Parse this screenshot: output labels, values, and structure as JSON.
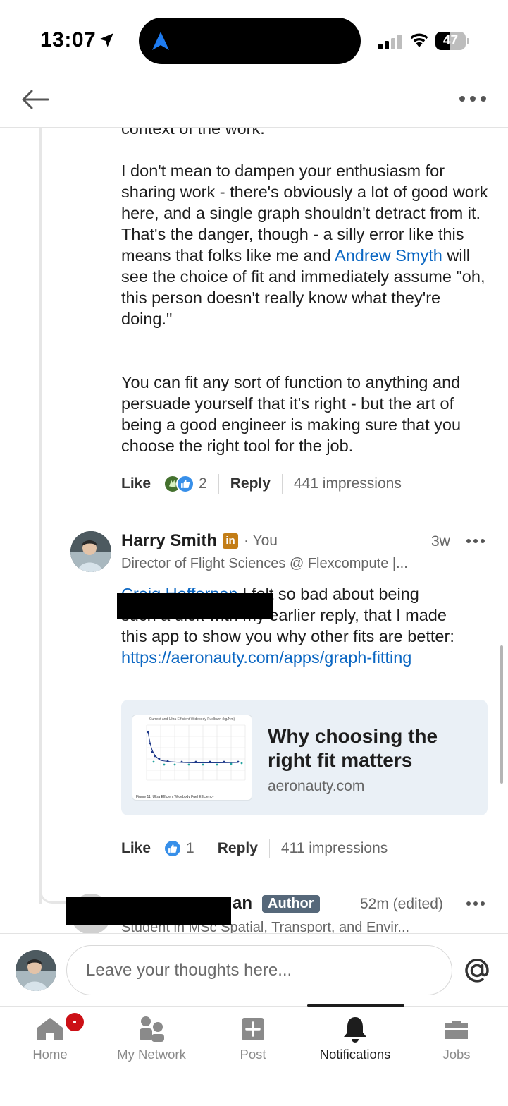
{
  "status_bar": {
    "time": "13:07",
    "battery": "47",
    "battery_level_percent": 47
  },
  "header": {
    "back_icon": "arrow-left-icon",
    "more_icon": "more-horizontal-icon"
  },
  "comment_1": {
    "cut_off_text": "context of the work.",
    "paragraph_1_part_1": "I don't mean to dampen your enthusiasm for sharing work - there's obviously a lot of good work here, and a single graph shouldn't detract from it. That's the danger, though - a silly error like this means that folks like me and ",
    "mention": "Andrew Smyth",
    "paragraph_1_part_2": " will see the choice of fit and immediately assume \"oh, this person doesn't really know what they're doing.\"",
    "paragraph_2": "You can fit any sort of function to anything and persuade yourself that it's right - but the art of being a good engineer is making sure that you choose the right tool for the job.",
    "actions": {
      "like_label": "Like",
      "reaction_count": "2",
      "reply_label": "Reply",
      "impressions": "441 impressions"
    }
  },
  "comment_2": {
    "author_name": "Harry Smith",
    "badge_letters": "in",
    "you_label": "You",
    "time_ago": "3w",
    "headline": "Director of Flight Sciences @ Flexcompute |...",
    "mention": "Craig Heffernan",
    "text_line_1_rest": " I felt so bad about being",
    "text_line_2": "such a dick with my earlier reply, that I made",
    "text_rest": "this app to show you why other fits are better: ",
    "link_url": "https://aeronauty.com/apps/graph-fitting",
    "link_card": {
      "title": "Why choosing the right fit matters",
      "domain": "aeronauty.com",
      "thumbnail_title": "Current and Ultra Efficient Widebody Fuelburn (kg/Nm)",
      "thumbnail_caption": "Figure 11: Ultra Efficient Widebody Fuel Efficiency"
    },
    "actions": {
      "like_label": "Like",
      "reaction_count": "1",
      "reply_label": "Reply",
      "impressions": "411 impressions"
    }
  },
  "comment_3": {
    "author_name_visible": "an",
    "author_badge": "Author",
    "time_ago": "52m (edited)",
    "headline": "Student in MSc Spatial, Transport, and Envir..."
  },
  "composer": {
    "placeholder": "Leave your thoughts here...",
    "mention_icon": "at-sign-icon"
  },
  "bottom_nav": {
    "items": [
      {
        "label": "Home",
        "icon": "home-icon"
      },
      {
        "label": "My Network",
        "icon": "network-icon"
      },
      {
        "label": "Post",
        "icon": "plus-square-icon"
      },
      {
        "label": "Notifications",
        "icon": "bell-icon"
      },
      {
        "label": "Jobs",
        "icon": "briefcase-icon"
      }
    ],
    "active": "Notifications"
  },
  "colors": {
    "link": "#0a66c2",
    "premium_badge": "#c37d16",
    "author_badge": "#56687a",
    "notification_badge": "#cc1016"
  }
}
